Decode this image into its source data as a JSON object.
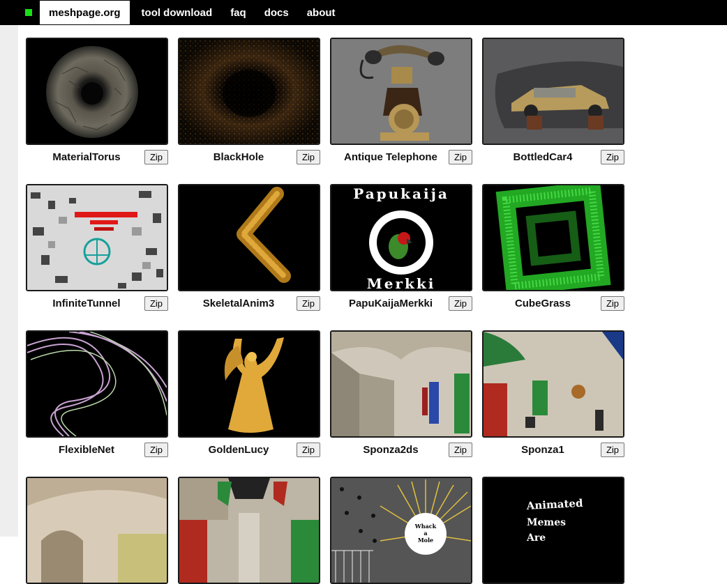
{
  "nav": {
    "logo_color": "#18e018",
    "items": [
      {
        "label": "meshpage.org",
        "active": true
      },
      {
        "label": "tool download",
        "active": false
      },
      {
        "label": "faq",
        "active": false
      },
      {
        "label": "docs",
        "active": false
      },
      {
        "label": "about",
        "active": false
      }
    ]
  },
  "zip_label": "Zip",
  "items": [
    {
      "title": "MaterialTorus",
      "thumb_icon": "stone-torus"
    },
    {
      "title": "BlackHole",
      "thumb_icon": "particle-ring"
    },
    {
      "title": "Antique Telephone",
      "thumb_icon": "telephone"
    },
    {
      "title": "BottledCar4",
      "thumb_icon": "car-in-bottle"
    },
    {
      "title": "InfiniteTunnel",
      "thumb_icon": "block-tunnel"
    },
    {
      "title": "SkeletalAnim3",
      "thumb_icon": "golden-chevron"
    },
    {
      "title": "PapuKaijaMerkki",
      "thumb_icon": "parrot-badge",
      "thumb_text_top": "Papukaija",
      "thumb_text_bottom": "Merkki"
    },
    {
      "title": "CubeGrass",
      "thumb_icon": "grass-square"
    },
    {
      "title": "FlexibleNet",
      "thumb_icon": "wave-net"
    },
    {
      "title": "GoldenLucy",
      "thumb_icon": "golden-statue"
    },
    {
      "title": "Sponza2ds",
      "thumb_icon": "sponza-hall"
    },
    {
      "title": "Sponza1",
      "thumb_icon": "sponza-curtains"
    },
    {
      "title": "",
      "thumb_icon": "sponza-arches"
    },
    {
      "title": "",
      "thumb_icon": "sponza-corridor"
    },
    {
      "title": "",
      "thumb_icon": "whack-a-mole",
      "thumb_text_lines": [
        "Whack",
        "a",
        "Mole"
      ]
    },
    {
      "title": "",
      "thumb_icon": "meme-text",
      "thumb_text_lines": [
        "Animated",
        "Memes",
        "Are"
      ]
    }
  ]
}
